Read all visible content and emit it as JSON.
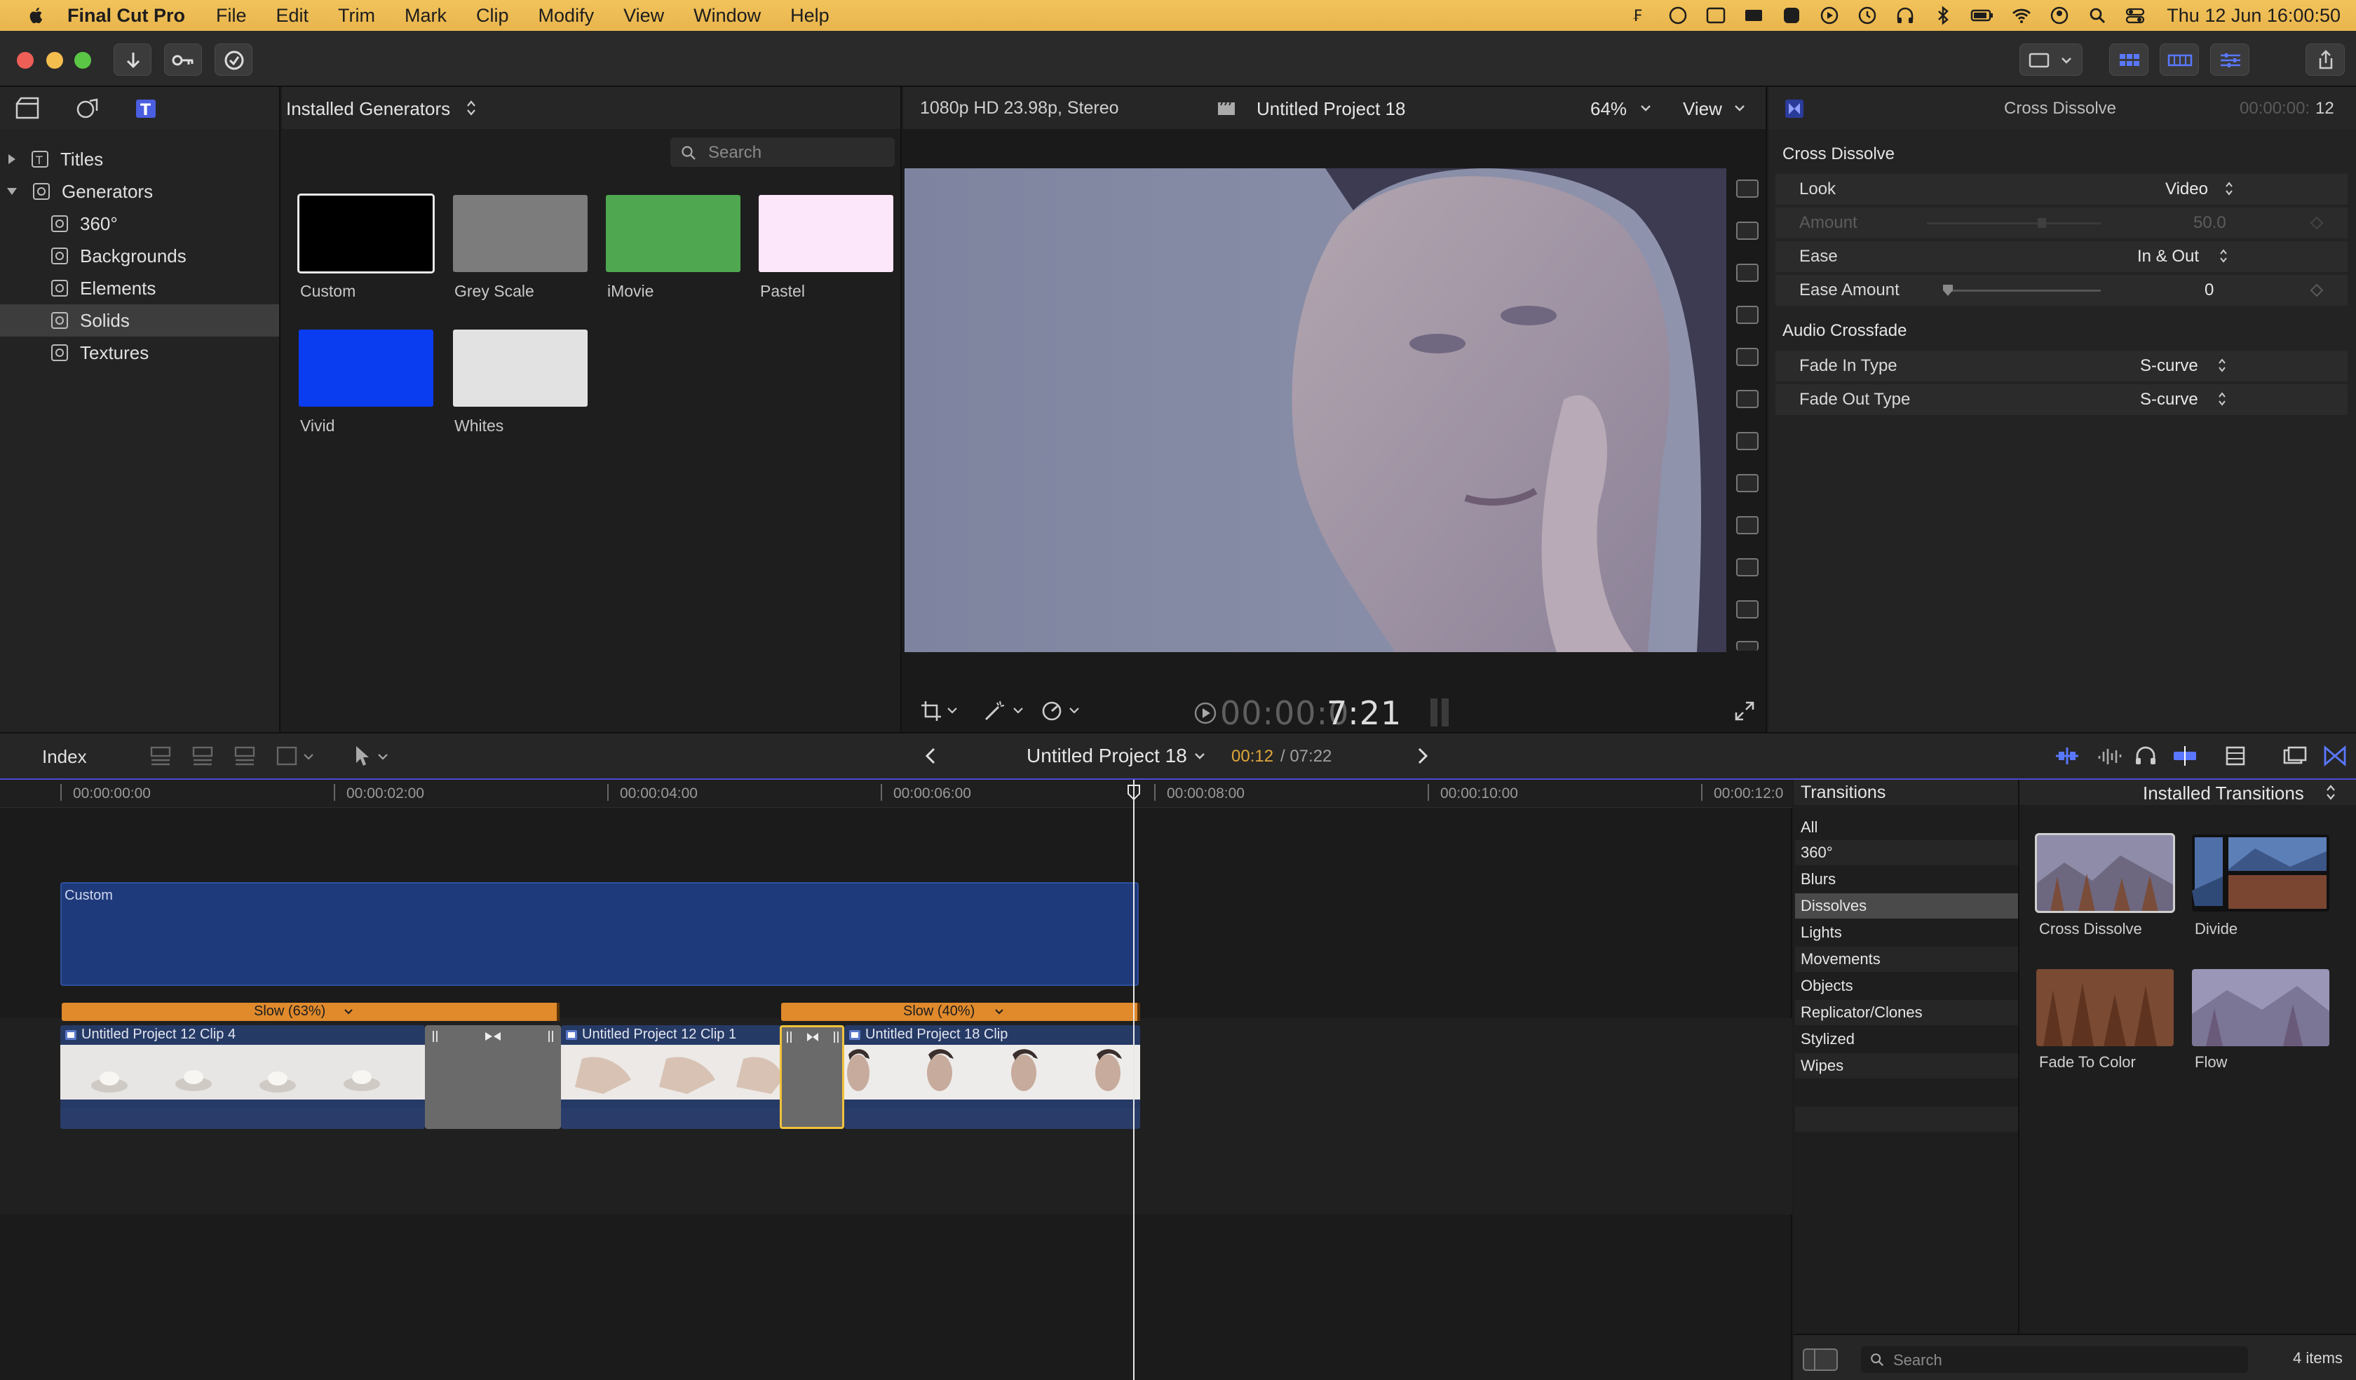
{
  "menubar": {
    "app_name": "Final Cut Pro",
    "items": [
      "File",
      "Edit",
      "Trim",
      "Mark",
      "Clip",
      "Modify",
      "View",
      "Window",
      "Help"
    ],
    "clock": "Thu 12 Jun  16:00:50"
  },
  "browser": {
    "sidebar": {
      "titles_label": "Titles",
      "generators_label": "Generators",
      "items": [
        "360°",
        "Backgrounds",
        "Elements",
        "Solids",
        "Textures"
      ],
      "selected": "Solids"
    },
    "header": "Installed Generators",
    "search_placeholder": "Search",
    "swatches": [
      {
        "label": "Custom",
        "color": "#000000"
      },
      {
        "label": "Grey Scale",
        "color": "#7c7c7c"
      },
      {
        "label": "iMovie",
        "color": "#4fa84f"
      },
      {
        "label": "Pastel",
        "color": "#fbe6fa"
      },
      {
        "label": "Vivid",
        "color": "#0a3cf0"
      },
      {
        "label": "Whites",
        "color": "#e2e2e2"
      }
    ]
  },
  "viewer": {
    "format": "1080p HD 23.98p, Stereo",
    "project": "Untitled Project 18",
    "zoom": "64%",
    "view_label": "View",
    "timecode_dim": "00:00:0",
    "timecode_bright": "7:21"
  },
  "inspector": {
    "title": "Cross Dissolve",
    "duration_dim": "00:00:00:",
    "duration_bright": "12",
    "section1": "Cross Dissolve",
    "rows1": [
      {
        "label": "Look",
        "value": "Video"
      },
      {
        "label": "Amount",
        "value": "50.0"
      },
      {
        "label": "Ease",
        "value": "In & Out"
      },
      {
        "label": "Ease Amount",
        "value": "0"
      }
    ],
    "section2": "Audio Crossfade",
    "rows2": [
      {
        "label": "Fade In Type",
        "value": "S-curve"
      },
      {
        "label": "Fade Out Type",
        "value": "S-curve"
      }
    ]
  },
  "timeline_bar": {
    "index_label": "Index",
    "project": "Untitled Project 18",
    "pos_current": "00:12",
    "pos_total": "/ 07:22"
  },
  "timeline": {
    "ruler": [
      "00:00:00:00",
      "00:00:02:00",
      "00:00:04:00",
      "00:00:06:00",
      "00:00:08:00",
      "00:00:10:00",
      "00:00:12:0"
    ],
    "generator_clip": "Custom",
    "speed1": "Slow (63%)",
    "speed2": "Slow (40%)",
    "clips": [
      "Untitled Project 12 Clip 4",
      "Untitled Project 12 Clip 1",
      "Untitled Project 18 Clip"
    ]
  },
  "transitions": {
    "title": "Transitions",
    "header": "Installed Transitions",
    "categories": [
      "All",
      "360°",
      "Blurs",
      "Dissolves",
      "Lights",
      "Movements",
      "Objects",
      "Replicator/Clones",
      "Stylized",
      "Wipes"
    ],
    "selected": "Dissolves",
    "items": [
      "Cross Dissolve",
      "Divide",
      "Fade To Color",
      "Flow"
    ],
    "search_placeholder": "Search",
    "count": "4 items"
  }
}
